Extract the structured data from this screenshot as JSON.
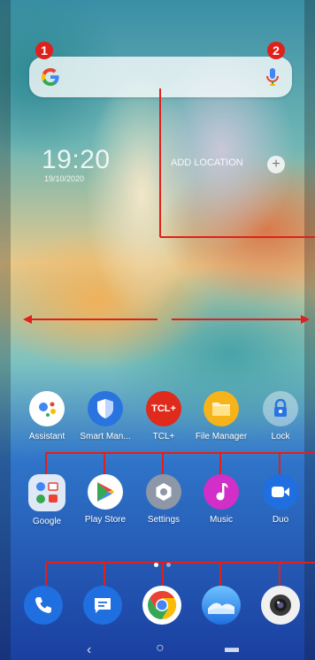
{
  "search": {
    "badge1": "1",
    "badge2": "2"
  },
  "clock": {
    "time": "19:20",
    "date": "19/10/2020",
    "add_location": "ADD LOCATION"
  },
  "row1": [
    {
      "label": "Assistant"
    },
    {
      "label": "Smart Man..."
    },
    {
      "label": "TCL+"
    },
    {
      "label": "File Manager"
    },
    {
      "label": "Lock"
    }
  ],
  "row2": [
    {
      "label": "Google"
    },
    {
      "label": "Play Store"
    },
    {
      "label": "Settings"
    },
    {
      "label": "Music"
    },
    {
      "label": "Duo"
    }
  ],
  "tcl_badge": "TCL+",
  "colors": {
    "annotation": "#e0201b",
    "accent_blue": "#1f6fe0"
  },
  "page_indicator": {
    "pages": 2,
    "current": 1
  }
}
